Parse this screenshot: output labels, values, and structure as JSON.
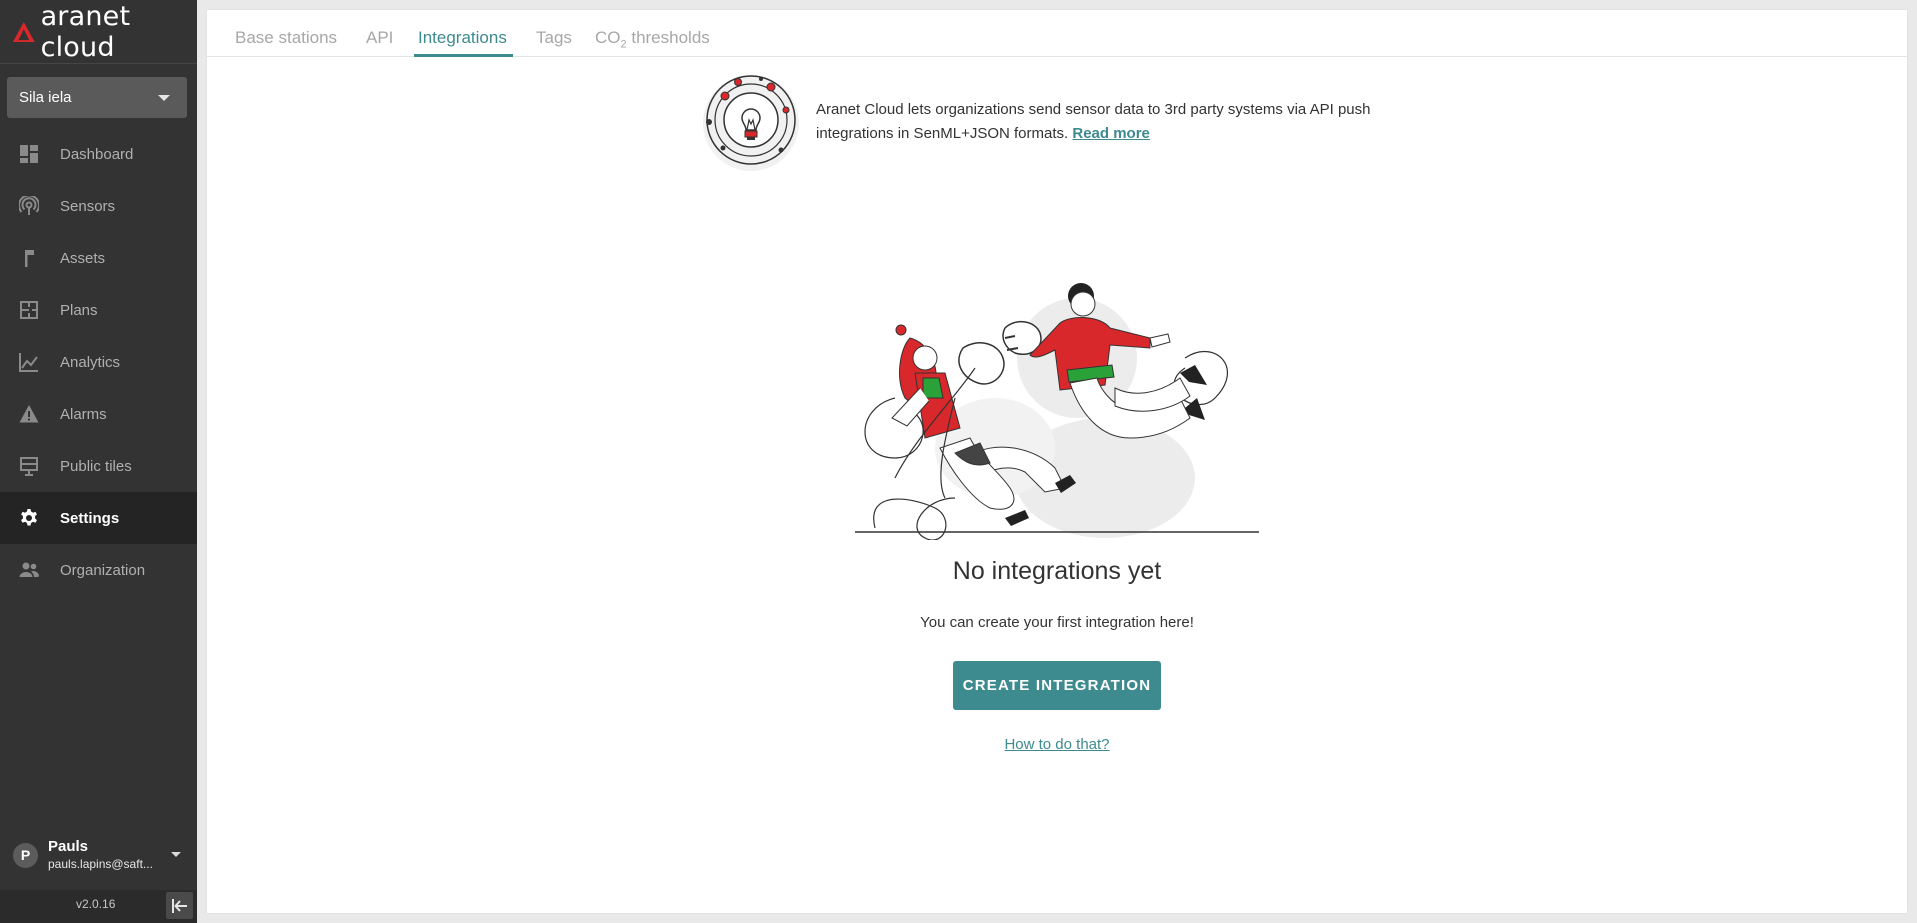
{
  "app": {
    "logo_text": "aranet cloud",
    "version": "v2.0.16"
  },
  "sidebar": {
    "org_select": {
      "value": "Sila iela"
    },
    "items": [
      {
        "label": "Dashboard",
        "icon": "dashboard-icon",
        "active": false
      },
      {
        "label": "Sensors",
        "icon": "sensors-icon",
        "active": false
      },
      {
        "label": "Assets",
        "icon": "assets-icon",
        "active": false
      },
      {
        "label": "Plans",
        "icon": "plans-icon",
        "active": false
      },
      {
        "label": "Analytics",
        "icon": "analytics-icon",
        "active": false
      },
      {
        "label": "Alarms",
        "icon": "alarm-icon",
        "active": false
      },
      {
        "label": "Public tiles",
        "icon": "public-tiles-icon",
        "active": false
      },
      {
        "label": "Settings",
        "icon": "gear-icon",
        "active": true
      },
      {
        "label": "Organization",
        "icon": "organization-icon",
        "active": false
      }
    ],
    "user": {
      "initial": "P",
      "name": "Pauls",
      "email": "pauls.lapins@saft..."
    }
  },
  "tabs": {
    "items": [
      {
        "label": "Base stations"
      },
      {
        "label": "API"
      },
      {
        "label": "Integrations",
        "active": true
      },
      {
        "label": "Tags"
      },
      {
        "label_prefix": "CO",
        "label_sub": "2",
        "label_suffix": " thresholds"
      }
    ]
  },
  "info": {
    "text": "Aranet Cloud lets organizations send sensor data to 3rd party systems via API push integrations in SenML+JSON formats.",
    "link": "Read more"
  },
  "empty_state": {
    "title": "No integrations yet",
    "subtitle": "You can create your first integration here!",
    "button": "CREATE INTEGRATION",
    "help_link": "How to do that?"
  },
  "colors": {
    "accent": "#3d8b8e",
    "sidebar_bg": "#333333",
    "brand_red": "#d9282b"
  }
}
